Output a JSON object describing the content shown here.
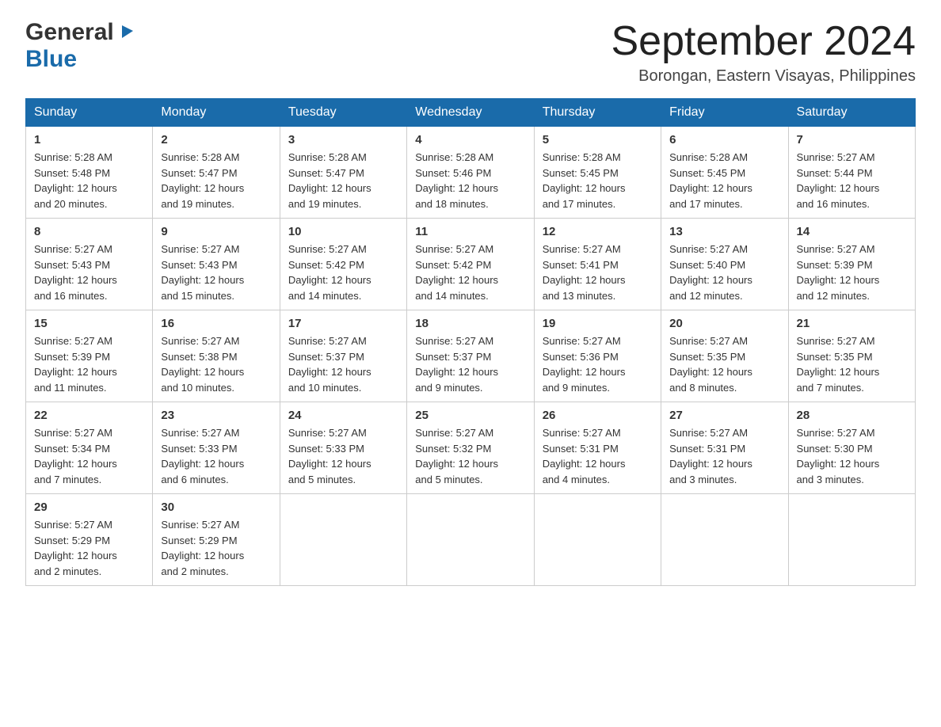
{
  "header": {
    "logo_general": "General",
    "logo_blue": "Blue",
    "month_title": "September 2024",
    "location": "Borongan, Eastern Visayas, Philippines"
  },
  "weekdays": [
    "Sunday",
    "Monday",
    "Tuesday",
    "Wednesday",
    "Thursday",
    "Friday",
    "Saturday"
  ],
  "weeks": [
    [
      {
        "day": "1",
        "sunrise": "5:28 AM",
        "sunset": "5:48 PM",
        "daylight": "12 hours and 20 minutes."
      },
      {
        "day": "2",
        "sunrise": "5:28 AM",
        "sunset": "5:47 PM",
        "daylight": "12 hours and 19 minutes."
      },
      {
        "day": "3",
        "sunrise": "5:28 AM",
        "sunset": "5:47 PM",
        "daylight": "12 hours and 19 minutes."
      },
      {
        "day": "4",
        "sunrise": "5:28 AM",
        "sunset": "5:46 PM",
        "daylight": "12 hours and 18 minutes."
      },
      {
        "day": "5",
        "sunrise": "5:28 AM",
        "sunset": "5:45 PM",
        "daylight": "12 hours and 17 minutes."
      },
      {
        "day": "6",
        "sunrise": "5:28 AM",
        "sunset": "5:45 PM",
        "daylight": "12 hours and 17 minutes."
      },
      {
        "day": "7",
        "sunrise": "5:27 AM",
        "sunset": "5:44 PM",
        "daylight": "12 hours and 16 minutes."
      }
    ],
    [
      {
        "day": "8",
        "sunrise": "5:27 AM",
        "sunset": "5:43 PM",
        "daylight": "12 hours and 16 minutes."
      },
      {
        "day": "9",
        "sunrise": "5:27 AM",
        "sunset": "5:43 PM",
        "daylight": "12 hours and 15 minutes."
      },
      {
        "day": "10",
        "sunrise": "5:27 AM",
        "sunset": "5:42 PM",
        "daylight": "12 hours and 14 minutes."
      },
      {
        "day": "11",
        "sunrise": "5:27 AM",
        "sunset": "5:42 PM",
        "daylight": "12 hours and 14 minutes."
      },
      {
        "day": "12",
        "sunrise": "5:27 AM",
        "sunset": "5:41 PM",
        "daylight": "12 hours and 13 minutes."
      },
      {
        "day": "13",
        "sunrise": "5:27 AM",
        "sunset": "5:40 PM",
        "daylight": "12 hours and 12 minutes."
      },
      {
        "day": "14",
        "sunrise": "5:27 AM",
        "sunset": "5:39 PM",
        "daylight": "12 hours and 12 minutes."
      }
    ],
    [
      {
        "day": "15",
        "sunrise": "5:27 AM",
        "sunset": "5:39 PM",
        "daylight": "12 hours and 11 minutes."
      },
      {
        "day": "16",
        "sunrise": "5:27 AM",
        "sunset": "5:38 PM",
        "daylight": "12 hours and 10 minutes."
      },
      {
        "day": "17",
        "sunrise": "5:27 AM",
        "sunset": "5:37 PM",
        "daylight": "12 hours and 10 minutes."
      },
      {
        "day": "18",
        "sunrise": "5:27 AM",
        "sunset": "5:37 PM",
        "daylight": "12 hours and 9 minutes."
      },
      {
        "day": "19",
        "sunrise": "5:27 AM",
        "sunset": "5:36 PM",
        "daylight": "12 hours and 9 minutes."
      },
      {
        "day": "20",
        "sunrise": "5:27 AM",
        "sunset": "5:35 PM",
        "daylight": "12 hours and 8 minutes."
      },
      {
        "day": "21",
        "sunrise": "5:27 AM",
        "sunset": "5:35 PM",
        "daylight": "12 hours and 7 minutes."
      }
    ],
    [
      {
        "day": "22",
        "sunrise": "5:27 AM",
        "sunset": "5:34 PM",
        "daylight": "12 hours and 7 minutes."
      },
      {
        "day": "23",
        "sunrise": "5:27 AM",
        "sunset": "5:33 PM",
        "daylight": "12 hours and 6 minutes."
      },
      {
        "day": "24",
        "sunrise": "5:27 AM",
        "sunset": "5:33 PM",
        "daylight": "12 hours and 5 minutes."
      },
      {
        "day": "25",
        "sunrise": "5:27 AM",
        "sunset": "5:32 PM",
        "daylight": "12 hours and 5 minutes."
      },
      {
        "day": "26",
        "sunrise": "5:27 AM",
        "sunset": "5:31 PM",
        "daylight": "12 hours and 4 minutes."
      },
      {
        "day": "27",
        "sunrise": "5:27 AM",
        "sunset": "5:31 PM",
        "daylight": "12 hours and 3 minutes."
      },
      {
        "day": "28",
        "sunrise": "5:27 AM",
        "sunset": "5:30 PM",
        "daylight": "12 hours and 3 minutes."
      }
    ],
    [
      {
        "day": "29",
        "sunrise": "5:27 AM",
        "sunset": "5:29 PM",
        "daylight": "12 hours and 2 minutes."
      },
      {
        "day": "30",
        "sunrise": "5:27 AM",
        "sunset": "5:29 PM",
        "daylight": "12 hours and 2 minutes."
      },
      null,
      null,
      null,
      null,
      null
    ]
  ],
  "labels": {
    "sunrise": "Sunrise:",
    "sunset": "Sunset:",
    "daylight": "Daylight:"
  }
}
